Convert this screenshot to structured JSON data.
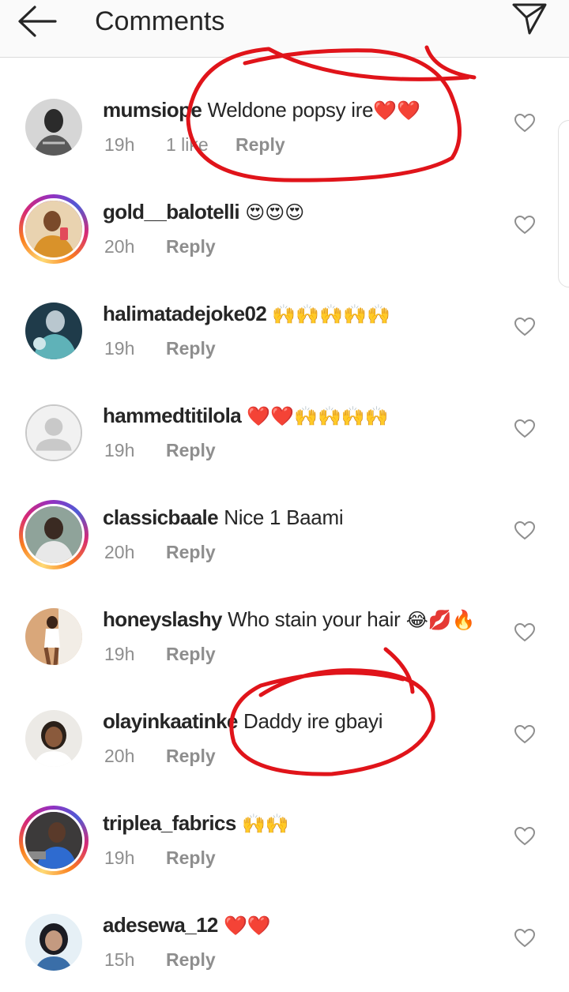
{
  "header": {
    "title": "Comments",
    "back_icon": "arrow-left-icon",
    "send_icon": "paper-plane-icon"
  },
  "colors": {
    "text": "#262626",
    "secondary": "#8e8e8e",
    "annotation": "#e0141a",
    "heart_emoji": "#e0141a",
    "ring_gradient": [
      "#feda75",
      "#fa7e1e",
      "#d62976",
      "#962fbf",
      "#4f5bd5"
    ]
  },
  "comments": [
    {
      "username": "mumsiope",
      "text": "Weldone popsy ire",
      "emoji": "❤️❤️",
      "time": "19h",
      "likes": "1 like",
      "reply": "Reply",
      "story_ring": false
    },
    {
      "username": "gold__balotelli",
      "text": "",
      "emoji": "😍😍😍",
      "time": "20h",
      "likes": "",
      "reply": "Reply",
      "story_ring": true
    },
    {
      "username": "halimatadejoke02",
      "text": "",
      "emoji": "🙌🙌🙌🙌🙌",
      "time": "19h",
      "likes": "",
      "reply": "Reply",
      "story_ring": false
    },
    {
      "username": "hammedtitilola",
      "text": "",
      "emoji": "❤️❤️🙌🙌🙌🙌",
      "time": "19h",
      "likes": "",
      "reply": "Reply",
      "story_ring": false
    },
    {
      "username": "classicbaale",
      "text": "Nice 1 Baami",
      "emoji": "",
      "time": "20h",
      "likes": "",
      "reply": "Reply",
      "story_ring": true
    },
    {
      "username": "honeyslashy",
      "text": "Who stain your hair",
      "emoji": "😂💋🔥",
      "time": "19h",
      "likes": "",
      "reply": "Reply",
      "story_ring": false
    },
    {
      "username": "olayinkaatinke",
      "text": "Daddy ire gbayi",
      "emoji": "",
      "time": "20h",
      "likes": "",
      "reply": "Reply",
      "story_ring": false
    },
    {
      "username": "triplea_fabrics",
      "text": "",
      "emoji": "🙌🙌",
      "time": "19h",
      "likes": "",
      "reply": "Reply",
      "story_ring": true
    },
    {
      "username": "adesewa_12",
      "text": "",
      "emoji": "❤️❤️",
      "time": "15h",
      "likes": "",
      "reply": "Reply",
      "story_ring": false
    }
  ]
}
